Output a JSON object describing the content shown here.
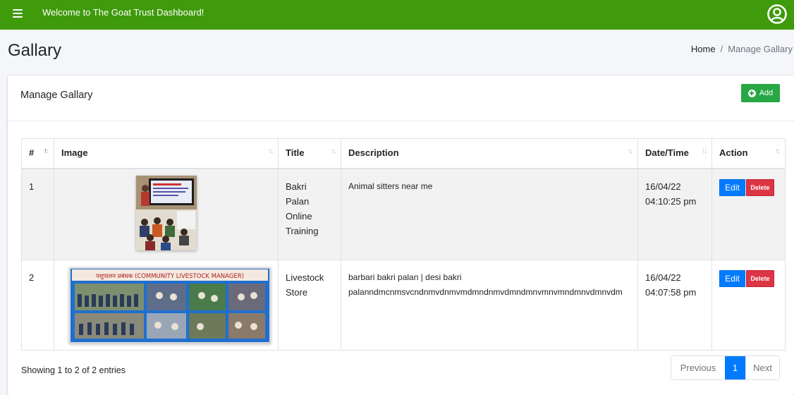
{
  "header": {
    "welcome": "Welcome to The Goat Trust Dashboard!",
    "bg_color": "#3f9a0c"
  },
  "page": {
    "title": "Gallary",
    "breadcrumb": {
      "home": "Home",
      "separator": "/",
      "current": "Manage Gallary"
    }
  },
  "card": {
    "title": "Manage Gallary",
    "add_label": "Add"
  },
  "table": {
    "columns": [
      "#",
      "Image",
      "Title",
      "Description",
      "Date/Time",
      "Action"
    ],
    "rows": [
      {
        "num": "1",
        "title_lines": [
          "Bakri",
          "Palan",
          "Online",
          "Training"
        ],
        "description": "Animal sitters near me",
        "date": "16/04/22",
        "time": "04:10:25 pm",
        "edit": "Edit",
        "delete": "Delete"
      },
      {
        "num": "2",
        "title_lines": [
          "Livestock",
          "Store"
        ],
        "description_lines": [
          "barbari bakri palan | desi bakri",
          "palanndmcnmsvcndnmvdnmvmdmndnmvdmndmnvmnvmndmnvdmnvdm"
        ],
        "date": "16/04/22",
        "time": "04:07:58 pm",
        "edit": "Edit",
        "delete": "Delete",
        "image_banner_text": "पशुपालन प्रबंधक (COMMUNITY LIVESTOCK MANAGER)"
      }
    ]
  },
  "footer": {
    "info": "Showing 1 to 2 of 2 entries",
    "prev": "Previous",
    "page": "1",
    "next": "Next"
  },
  "colors": {
    "accent_green": "#28a745",
    "primary_blue": "#007bff",
    "danger_red": "#dc3545"
  },
  "icons": [
    "hamburger-icon",
    "user-circle-icon",
    "plus-circle-icon",
    "sort-icon"
  ]
}
